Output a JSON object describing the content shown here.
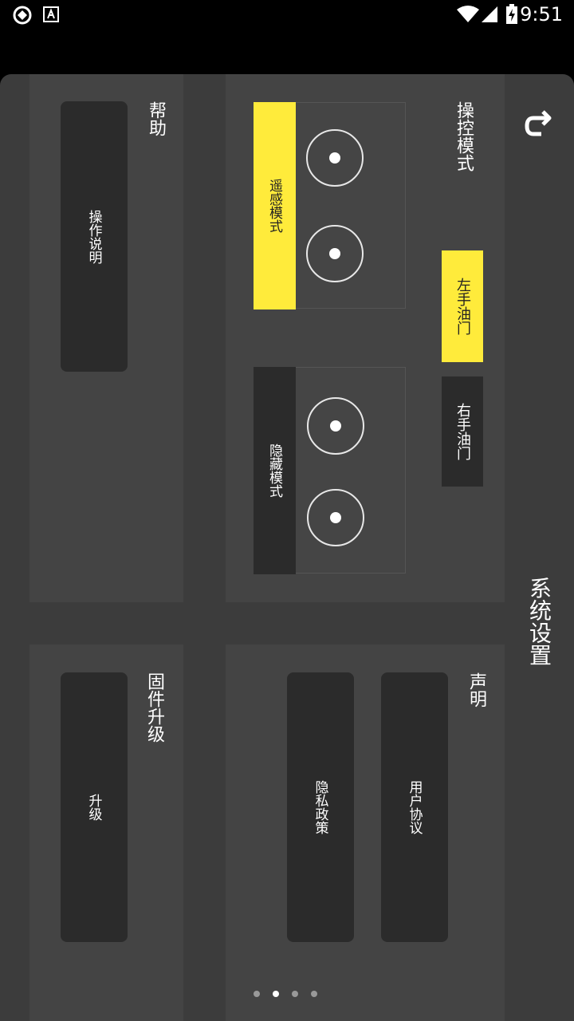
{
  "status_bar": {
    "time": "9:51"
  },
  "page": {
    "title": "系统设置",
    "back_icon": "back-arrow-icon"
  },
  "control": {
    "title": "操控模式",
    "throttle": {
      "left": "左手油门",
      "right": "右手油门",
      "selected": "left"
    },
    "modes": {
      "remote": "遥感模式",
      "hidden": "隐藏模式",
      "selected": "remote"
    }
  },
  "help": {
    "title": "帮助",
    "instructions": "操作说明"
  },
  "statement": {
    "title": "声明",
    "user_agreement": "用户协议",
    "privacy_policy": "隐私政策"
  },
  "firmware": {
    "title": "固件升级",
    "upgrade": "升级"
  },
  "colors": {
    "accent": "#FFEB3B",
    "panel": "#3C3C3C",
    "card": "#444444",
    "button": "#2B2B2B"
  },
  "pager": {
    "count": 4,
    "active": 1
  }
}
